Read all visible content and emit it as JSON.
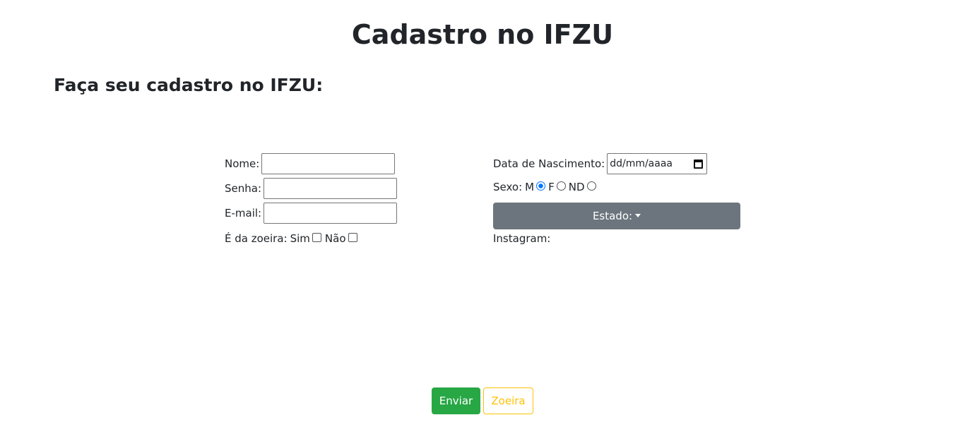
{
  "header": {
    "title": "Cadastro no IFZU",
    "subtitle": "Faça seu cadastro no IFZU:"
  },
  "form": {
    "nome": {
      "label": "Nome:",
      "value": ""
    },
    "senha": {
      "label": "Senha:",
      "value": ""
    },
    "email": {
      "label": "E-mail:",
      "value": ""
    },
    "zoeira": {
      "label": "É da zoeira:",
      "options": [
        {
          "label": "Sim",
          "checked": false
        },
        {
          "label": "Não",
          "checked": false
        }
      ]
    },
    "nascimento": {
      "label": "Data de Nascimento:",
      "placeholder": "dd/mm/aaaa"
    },
    "sexo": {
      "label": "Sexo:",
      "options": [
        {
          "label": "M",
          "checked": true
        },
        {
          "label": "F",
          "checked": false
        },
        {
          "label": "ND",
          "checked": false
        }
      ]
    },
    "estado": {
      "label": "Estado:"
    },
    "instagram": {
      "label": "Instagram:"
    }
  },
  "buttons": {
    "enviar": "Enviar",
    "zoeira": "Zoeira"
  },
  "colors": {
    "success": "#28a745",
    "warning": "#ffc107",
    "secondary": "#6c757d",
    "radio_checked": "#0075ff"
  }
}
